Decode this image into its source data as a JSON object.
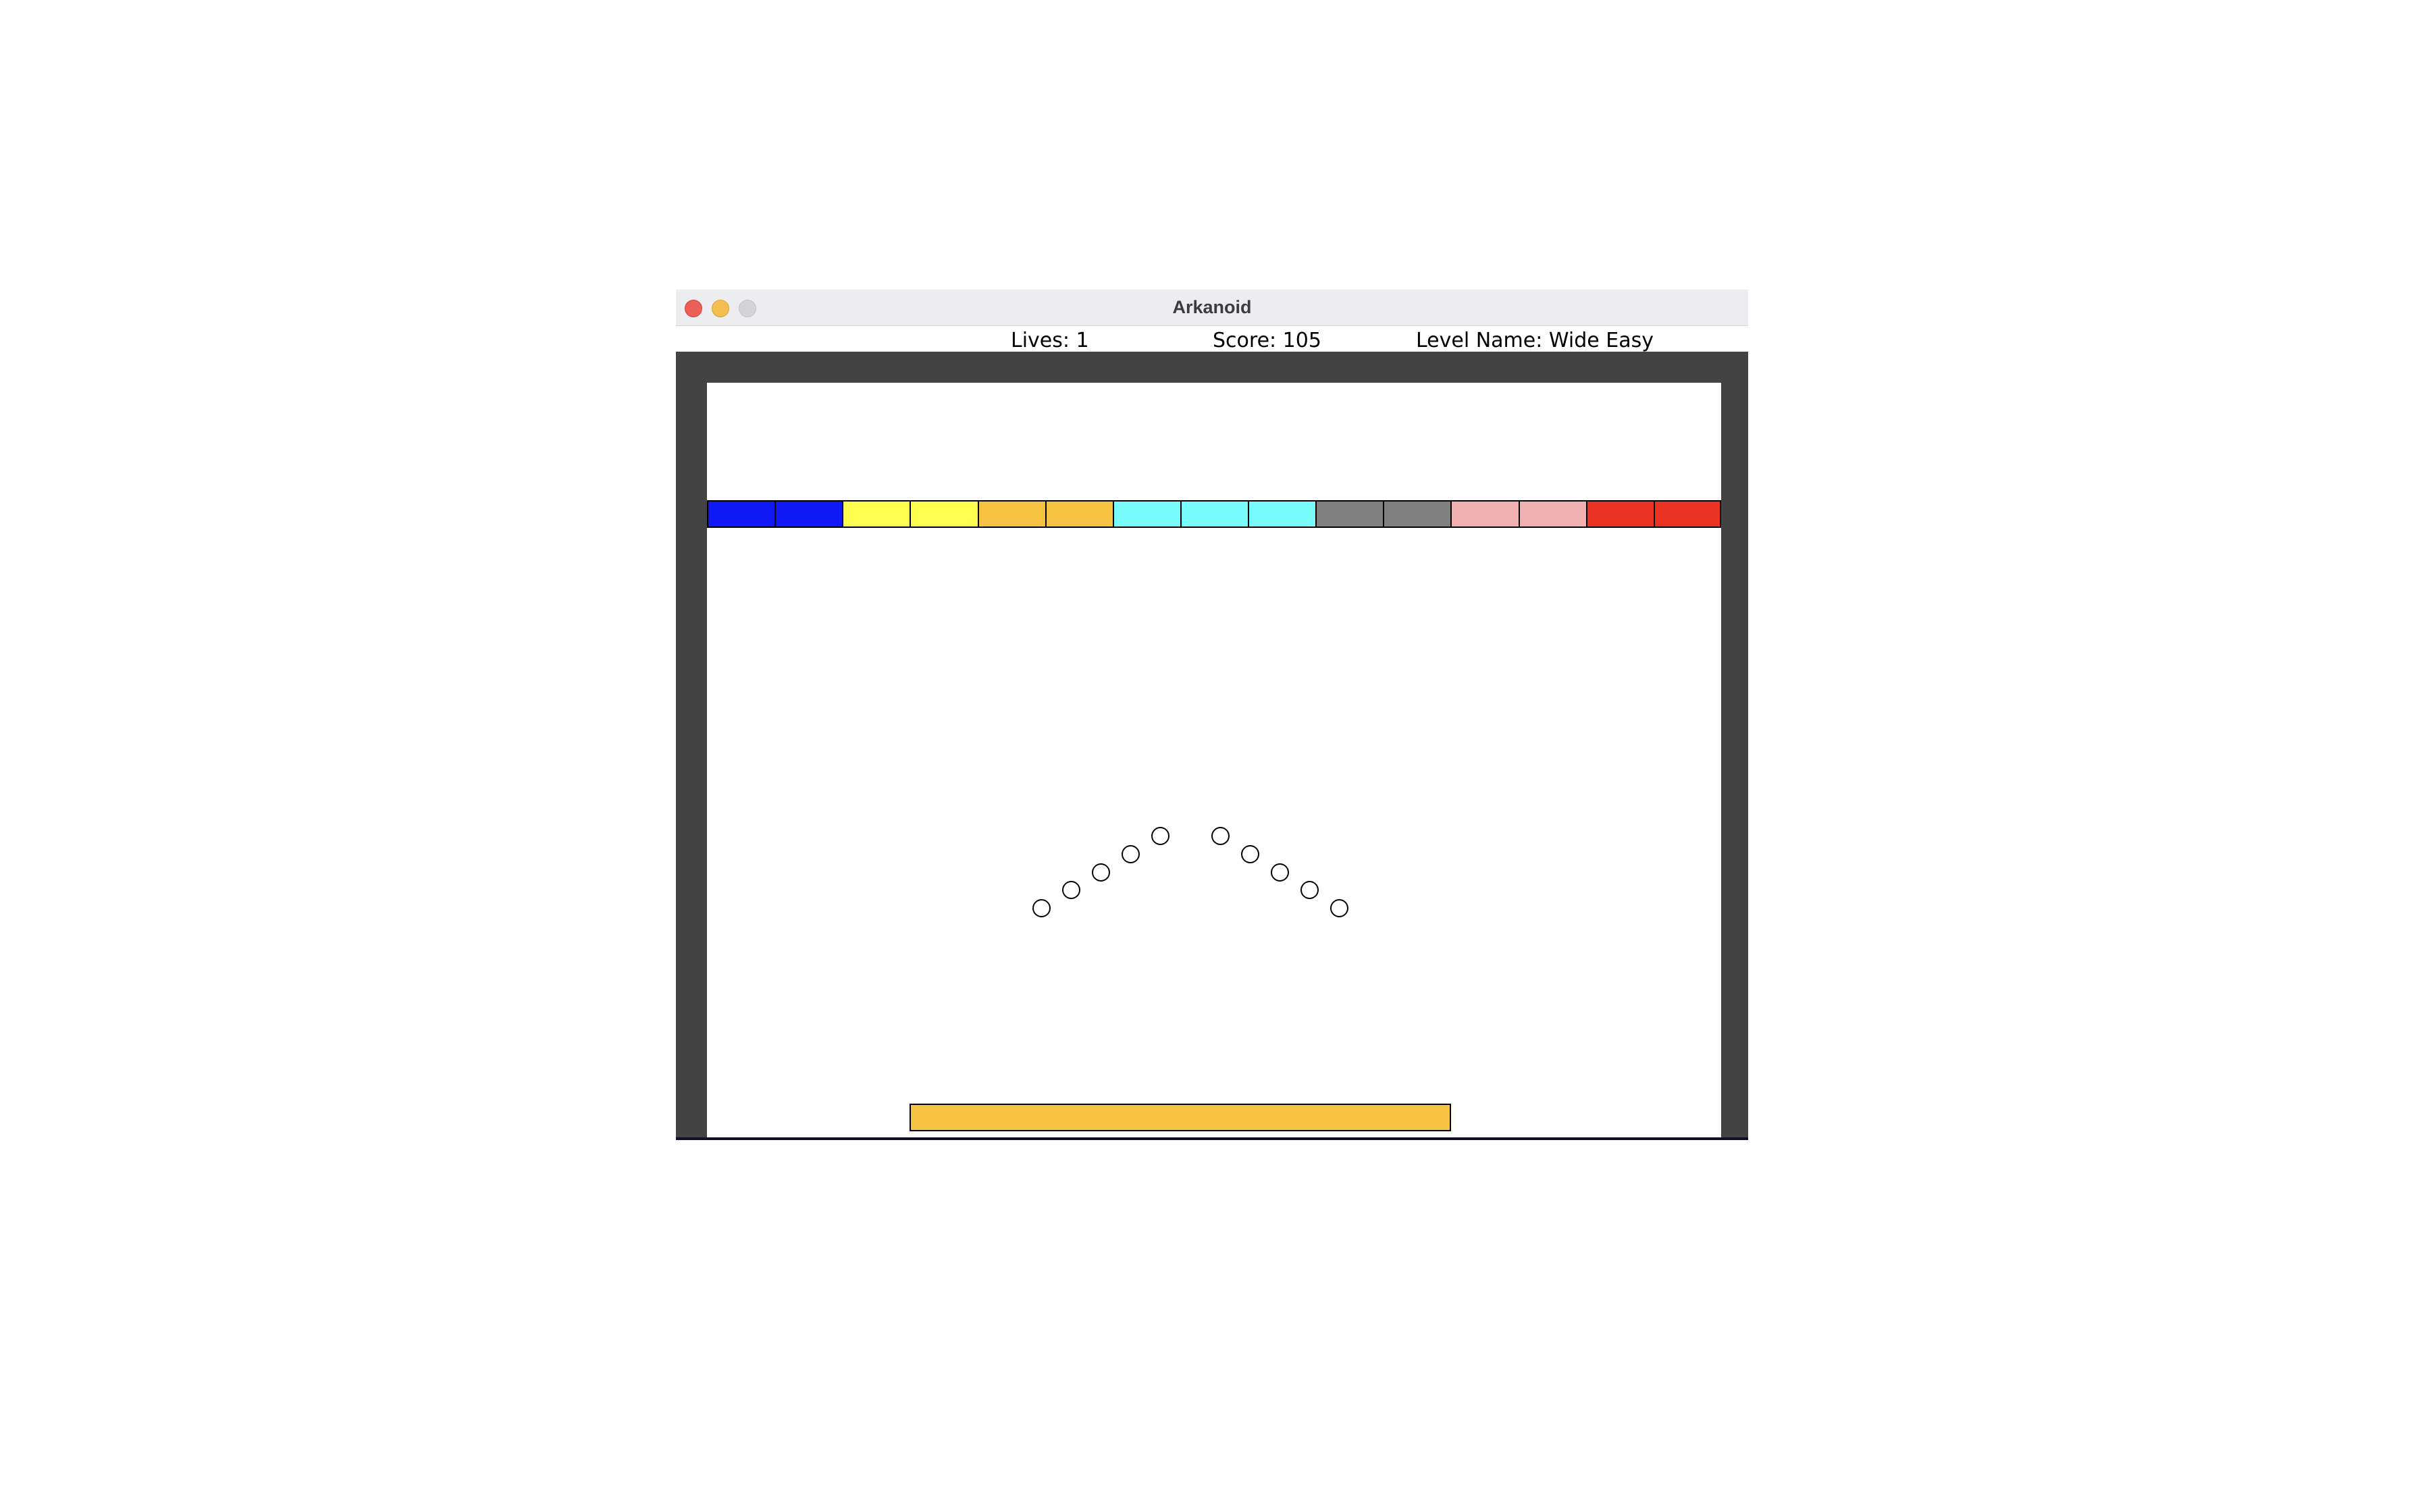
{
  "window": {
    "title": "Arkanoid"
  },
  "hud": {
    "lives": "Lives: 1",
    "score": "Score: 105",
    "level": "Level Name: Wide Easy"
  },
  "colors": {
    "frame": "#434343",
    "background": "#ffffff",
    "paddle": "#f5c242",
    "ball_fill": "#ffffff",
    "outline": "#000000"
  },
  "bricks": [
    {
      "color": "#1018f5"
    },
    {
      "color": "#1018f5"
    },
    {
      "color": "#fdfd50"
    },
    {
      "color": "#fdfd50"
    },
    {
      "color": "#f5c242"
    },
    {
      "color": "#f5c242"
    },
    {
      "color": "#78fbfb"
    },
    {
      "color": "#78fbfb"
    },
    {
      "color": "#78fbfb"
    },
    {
      "color": "#808080"
    },
    {
      "color": "#808080"
    },
    {
      "color": "#f0b0b1"
    },
    {
      "color": "#f0b0b1"
    },
    {
      "color": "#ea3323"
    },
    {
      "color": "#ea3323"
    }
  ],
  "ball_count": 10
}
